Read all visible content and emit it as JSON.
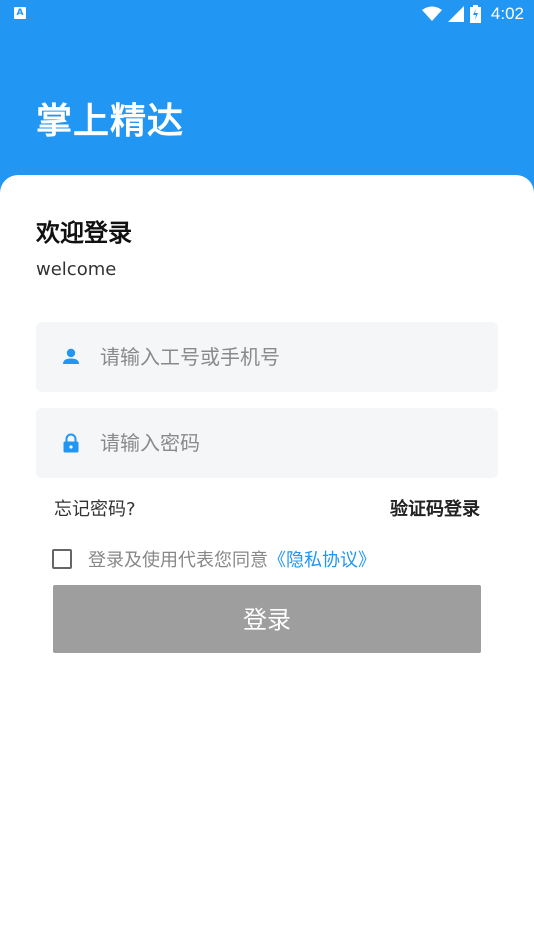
{
  "status_bar": {
    "left_icon_glyph": "A",
    "time": "4:02",
    "icons": [
      "wifi-icon",
      "signal-icon",
      "battery-icon"
    ]
  },
  "app_title": "掌上精达",
  "login": {
    "title": "欢迎登录",
    "subtitle": "welcome",
    "username_placeholder": "请输入工号或手机号",
    "password_placeholder": "请输入密码",
    "forgot_password": "忘记密码?",
    "code_login": "验证码登录",
    "agreement_text": "登录及使用代表您同意",
    "privacy_link": "《隐私协议》",
    "submit_label": "登录"
  },
  "colors": {
    "brand": "#2196f3",
    "button_disabled": "#9e9e9e",
    "input_bg": "#f5f6f8"
  }
}
